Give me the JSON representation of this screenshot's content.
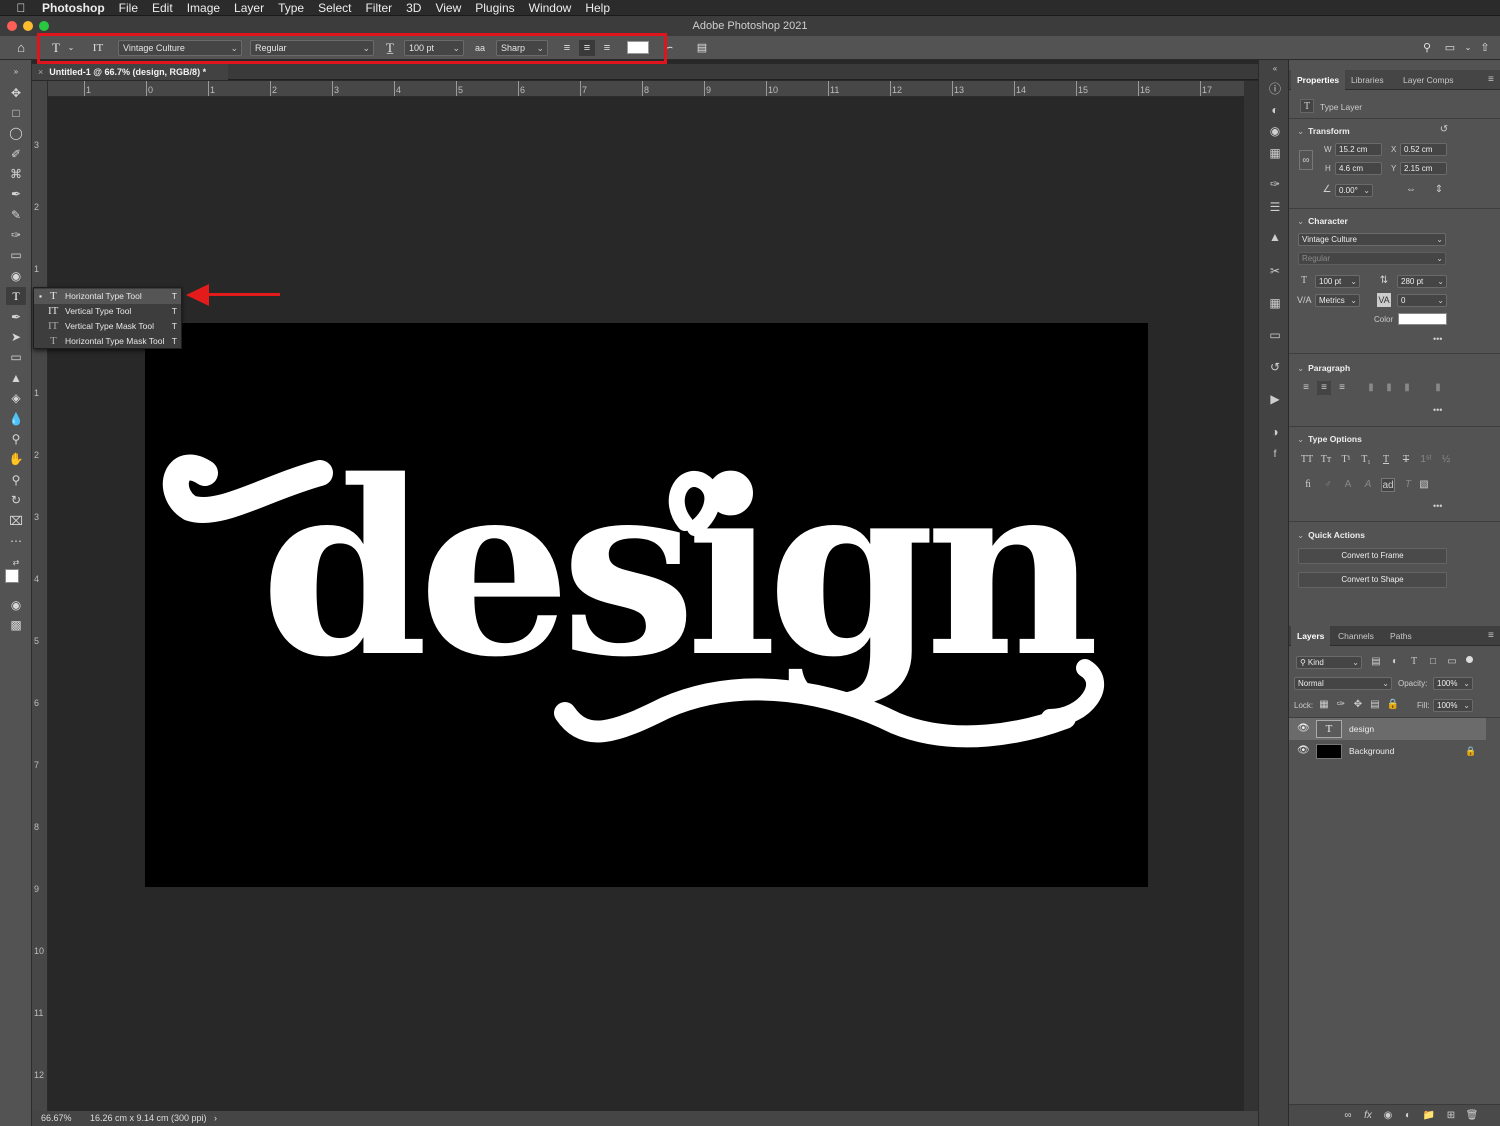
{
  "menubar": {
    "items": [
      "Photoshop",
      "File",
      "Edit",
      "Image",
      "Layer",
      "Type",
      "Select",
      "Filter",
      "3D",
      "View",
      "Plugins",
      "Window",
      "Help"
    ]
  },
  "window": {
    "title": "Adobe Photoshop 2021"
  },
  "options_bar": {
    "tool_icon": "T",
    "orientation_icon": "IT",
    "font_family": "Vintage Culture",
    "font_style": "Regular",
    "font_size": "100 pt",
    "aa_icon": "aa",
    "antialias": "Sharp",
    "text_color": "#ffffff"
  },
  "document": {
    "tab_title": "Untitled-1 @ 66.7% (design, RGB/8) *",
    "canvas_text": "design",
    "canvas_bg": "#000000"
  },
  "rulers": {
    "h_ticks": [
      "1",
      "0",
      "1",
      "2",
      "3",
      "4",
      "5",
      "6",
      "7",
      "8",
      "9",
      "10",
      "11",
      "12",
      "13",
      "14",
      "15",
      "16",
      "17"
    ],
    "v_ticks": [
      "3",
      "2",
      "1",
      "0",
      "1",
      "2",
      "3",
      "4",
      "5",
      "6",
      "7",
      "8",
      "9",
      "10",
      "11",
      "12"
    ]
  },
  "status": {
    "zoom": "66.67%",
    "doc_info": "16.26 cm x 9.14 cm (300 ppi)",
    "arrow": "›"
  },
  "type_flyout": {
    "items": [
      {
        "label": "Horizontal Type Tool",
        "shortcut": "T",
        "icon": "T",
        "selected": true
      },
      {
        "label": "Vertical Type Tool",
        "shortcut": "T",
        "icon": "IT",
        "selected": false
      },
      {
        "label": "Vertical Type Mask Tool",
        "shortcut": "T",
        "icon": "IT",
        "selected": false
      },
      {
        "label": "Horizontal Type Mask Tool",
        "shortcut": "T",
        "icon": "T",
        "selected": false
      }
    ]
  },
  "properties": {
    "tabs": [
      "Properties",
      "Libraries",
      "Layer Comps"
    ],
    "layer_type": "Type Layer",
    "transform": {
      "title": "Transform",
      "w_label": "W",
      "w": "15.2 cm",
      "h_label": "H",
      "h": "4.6 cm",
      "x_label": "X",
      "x": "0.52 cm",
      "y_label": "Y",
      "y": "2.15 cm",
      "angle": "0.00°"
    },
    "character": {
      "title": "Character",
      "font": "Vintage Culture",
      "style": "Regular",
      "size": "100 pt",
      "leading": "280 pt",
      "kerning": "Metrics",
      "tracking": "0",
      "color_label": "Color",
      "color": "#ffffff",
      "more": "•••"
    },
    "paragraph": {
      "title": "Paragraph",
      "more": "•••"
    },
    "type_options": {
      "title": "Type Options",
      "more": "•••"
    },
    "quick_actions": {
      "title": "Quick Actions",
      "buttons": [
        "Convert to Frame",
        "Convert to Shape"
      ]
    }
  },
  "layers": {
    "tabs": [
      "Layers",
      "Channels",
      "Paths"
    ],
    "filter_kind": "Kind",
    "blend_mode": "Normal",
    "opacity_label": "Opacity:",
    "opacity": "100%",
    "lock_label": "Lock:",
    "fill_label": "Fill:",
    "fill": "100%",
    "items": [
      {
        "name": "design",
        "kind": "type",
        "visible": true,
        "selected": true,
        "thumb": "T"
      },
      {
        "name": "Background",
        "kind": "background",
        "visible": true,
        "selected": false,
        "locked": true
      }
    ]
  },
  "colors": {
    "accent_red": "#e0141c",
    "foreground": "#ffffff",
    "background_swatch": "#000000"
  }
}
